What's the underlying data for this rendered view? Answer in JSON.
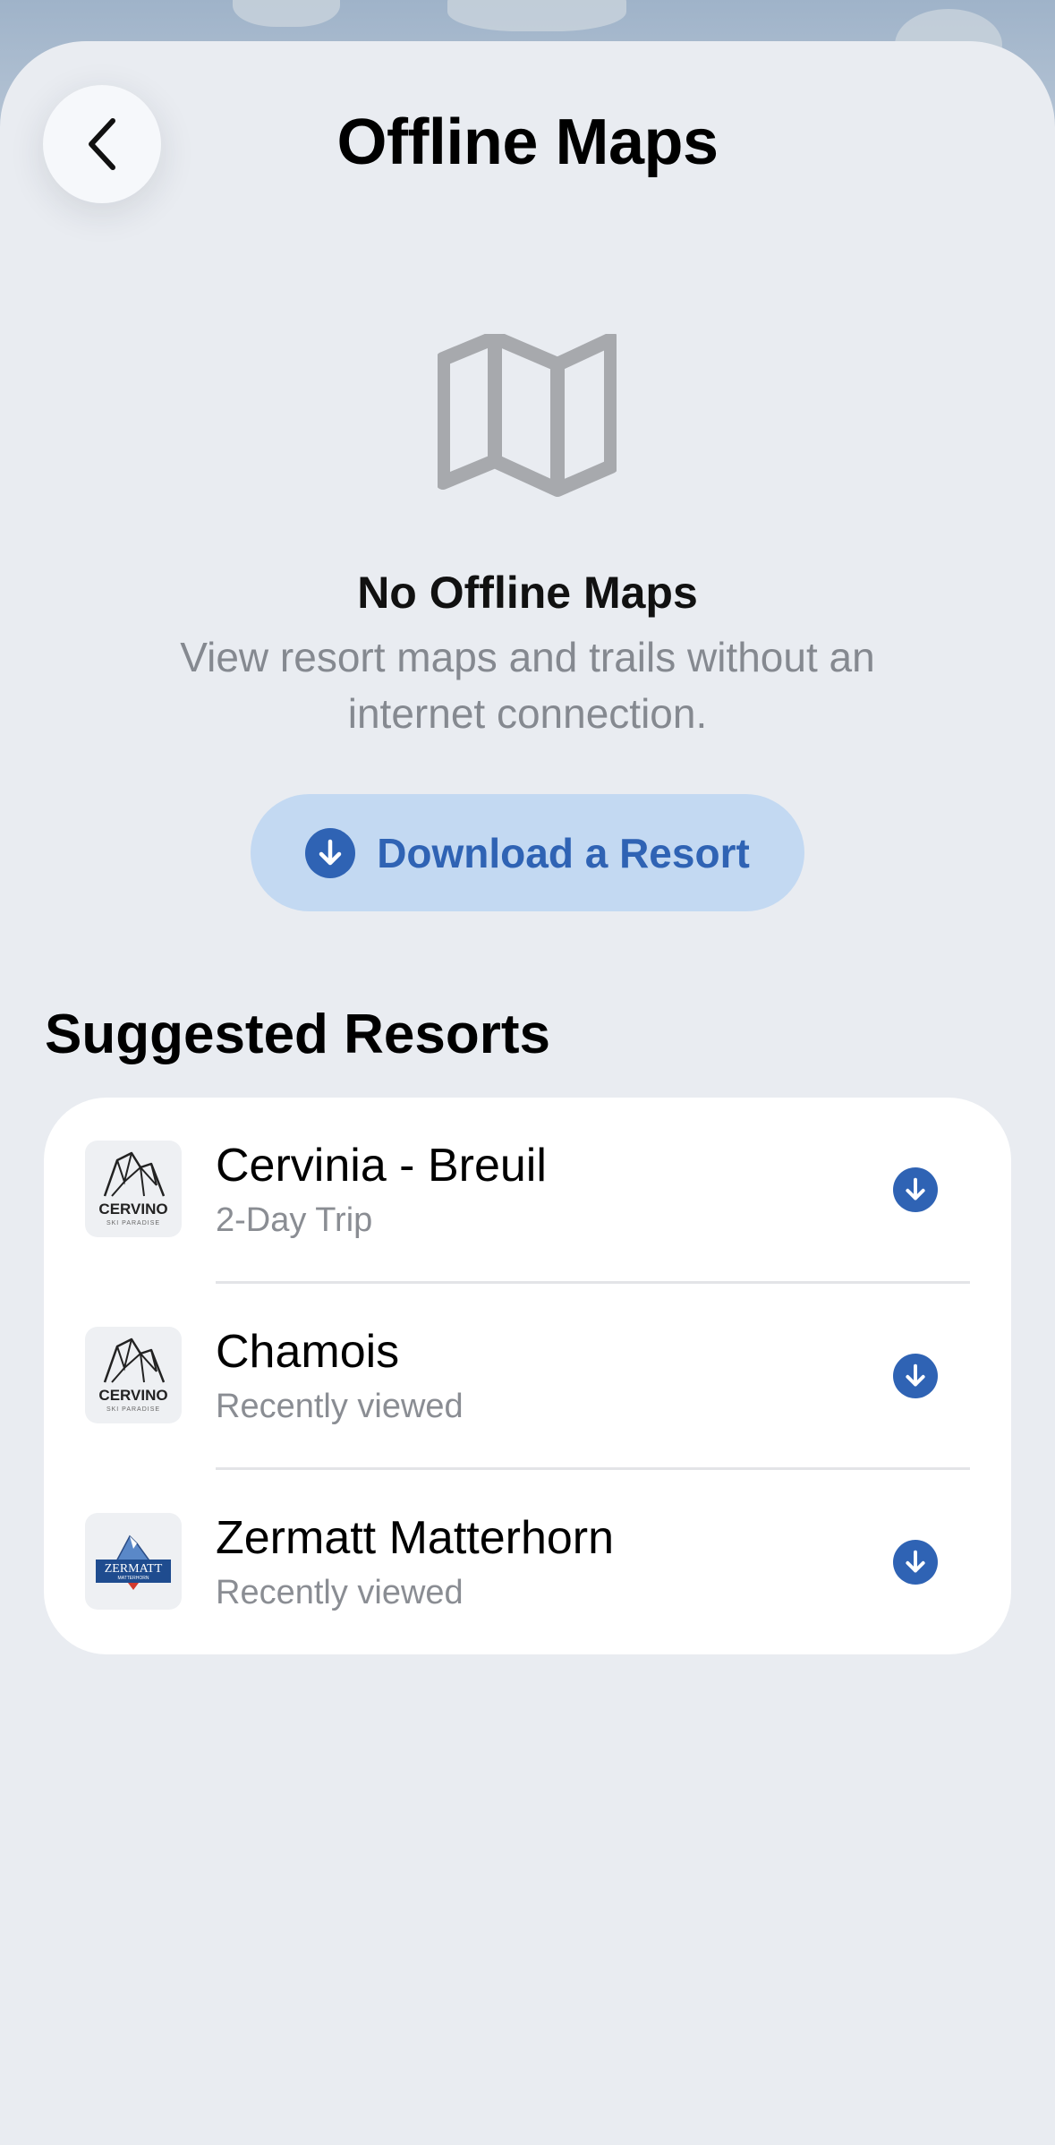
{
  "header": {
    "title": "Offline Maps",
    "back_icon": "chevron-left-icon"
  },
  "empty_state": {
    "icon": "map-icon",
    "title": "No Offline Maps",
    "subtitle": "View resort maps and trails without an internet connection.",
    "button_label": "Download a Resort",
    "button_icon": "download-circle-icon"
  },
  "suggested": {
    "title": "Suggested Resorts",
    "items": [
      {
        "name": "Cervinia - Breuil",
        "subtitle": "2-Day Trip",
        "logo": "cervino-logo"
      },
      {
        "name": "Chamois",
        "subtitle": "Recently viewed",
        "logo": "cervino-logo"
      },
      {
        "name": "Zermatt Matterhorn",
        "subtitle": "Recently viewed",
        "logo": "zermatt-logo"
      }
    ]
  },
  "logos": {
    "cervino_text": "CERVINO",
    "cervino_tagline": "SKI PARADISE",
    "zermatt_text": "ZERMATT",
    "zermatt_tagline": "MATTERHORN"
  },
  "colors": {
    "accent": "#2f63b4",
    "button_bg": "#c3d9f2",
    "sheet_bg": "#e9ecf1",
    "card_bg": "#ffffff",
    "secondary_text": "#858990"
  }
}
